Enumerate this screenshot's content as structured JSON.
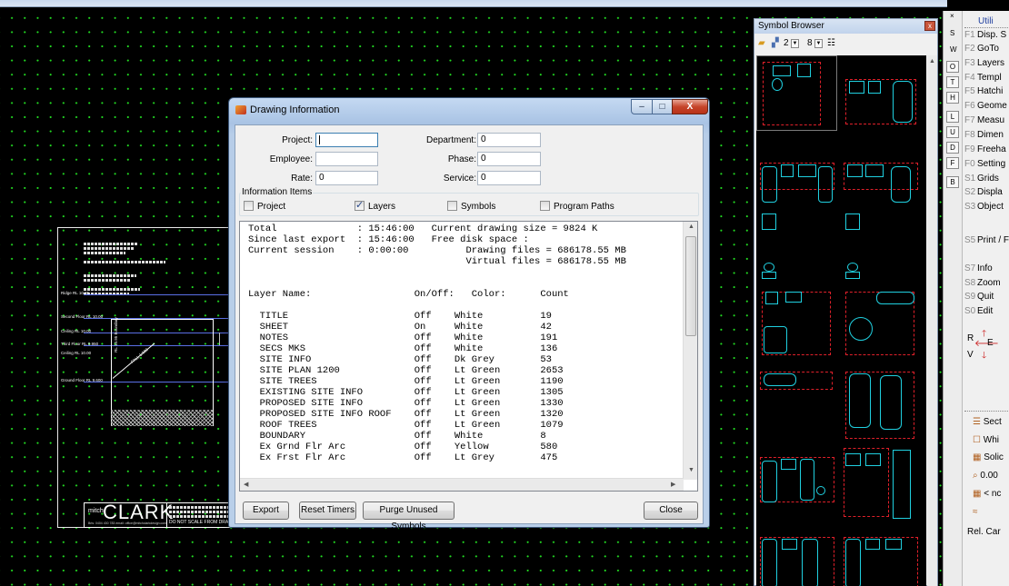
{
  "dialog": {
    "title": "Drawing Information",
    "caption_buttons": {
      "minimize": "–",
      "maximize": "□",
      "close": "X"
    },
    "fields": {
      "project_label": "Project:",
      "project_value": "",
      "employee_label": "Employee:",
      "employee_value": "",
      "rate_label": "Rate:",
      "rate_value": "0",
      "department_label": "Department:",
      "department_value": "0",
      "phase_label": "Phase:",
      "phase_value": "0",
      "service_label": "Service:",
      "service_value": "0"
    },
    "info_items": {
      "legend": "Information Items",
      "project": {
        "label": "Project",
        "checked": false
      },
      "layers": {
        "label": "Layers",
        "checked": true
      },
      "symbols": {
        "label": "Symbols",
        "checked": false
      },
      "program_paths": {
        "label": "Program Paths",
        "checked": false
      }
    },
    "summary_lines": [
      "Total              : 15:46:00   Current drawing size = 9824 K",
      "Since last export  : 15:46:00   Free disk space :",
      "Current session    : 0:00:00          Drawing files = 686178.55 MB",
      "                                      Virtual files = 686178.55 MB"
    ],
    "layer_table": {
      "headers": {
        "name": "Layer Name:",
        "onoff": "On/Off:",
        "color": "Color:",
        "count": "Count"
      },
      "rows": [
        {
          "name": "TITLE",
          "onoff": "Off",
          "color": "White",
          "count": "19"
        },
        {
          "name": "SHEET",
          "onoff": "On",
          "color": "White",
          "count": "42"
        },
        {
          "name": "NOTES",
          "onoff": "Off",
          "color": "White",
          "count": "191"
        },
        {
          "name": "SECS MKS",
          "onoff": "Off",
          "color": "White",
          "count": "136"
        },
        {
          "name": "SITE INFO",
          "onoff": "Off",
          "color": "Dk Grey",
          "count": "53"
        },
        {
          "name": "SITE PLAN 1200",
          "onoff": "Off",
          "color": "Lt Green",
          "count": "2653"
        },
        {
          "name": "SITE TREES",
          "onoff": "Off",
          "color": "Lt Green",
          "count": "1190"
        },
        {
          "name": "EXISTING SITE INFO",
          "onoff": "Off",
          "color": "Lt Green",
          "count": "1305"
        },
        {
          "name": "PROPOSED SITE INFO",
          "onoff": "Off",
          "color": "Lt Green",
          "count": "1330"
        },
        {
          "name": "PROPOSED SITE INFO ROOF",
          "onoff": "Off",
          "color": "Lt Green",
          "count": "1320"
        },
        {
          "name": "ROOF TREES",
          "onoff": "Off",
          "color": "Lt Green",
          "count": "1079"
        },
        {
          "name": "BOUNDARY",
          "onoff": "Off",
          "color": "White",
          "count": "8"
        },
        {
          "name": "Ex Grnd Flr Arc",
          "onoff": "Off",
          "color": "Yellow",
          "count": "580"
        },
        {
          "name": "Ex Frst Flr Arc",
          "onoff": "Off",
          "color": "Lt Grey",
          "count": "475"
        }
      ]
    },
    "buttons": {
      "export": "Export",
      "reset_timers": "Reset Timers",
      "purge": "Purge Unused Symbols",
      "close": "Close"
    }
  },
  "symbol_browser": {
    "title": "Symbol Browser",
    "close": "x",
    "columns_value": "2",
    "rows_value": "8"
  },
  "utilities": {
    "title": "Utili",
    "close_x": "×",
    "items": [
      {
        "key": "F1",
        "label": "Disp. S"
      },
      {
        "key": "F2",
        "label": "GoTo"
      },
      {
        "key": "F3",
        "label": "Layers"
      },
      {
        "key": "F4",
        "label": "Templ"
      },
      {
        "key": "F5",
        "label": "Hatchi"
      },
      {
        "key": "F6",
        "label": "Geome"
      },
      {
        "key": "F7",
        "label": "Measu"
      },
      {
        "key": "F8",
        "label": "Dimen"
      },
      {
        "key": "F9",
        "label": "Freeha"
      },
      {
        "key": "F0",
        "label": "Setting"
      },
      {
        "key": "S1",
        "label": "Grids"
      },
      {
        "key": "S2",
        "label": "Displa"
      },
      {
        "key": "S3",
        "label": "Object"
      },
      {
        "key": "S5",
        "label": "Print / F"
      },
      {
        "key": "S7",
        "label": "Info"
      },
      {
        "key": "S8",
        "label": "Zoom"
      },
      {
        "key": "S9",
        "label": "Quit"
      },
      {
        "key": "S0",
        "label": "Edit"
      }
    ],
    "side_letters": [
      "S",
      "W",
      "O",
      "T",
      "H",
      "L",
      "U",
      "D",
      "F",
      "B"
    ],
    "nav": {
      "r": "R",
      "e": "E",
      "v": "V"
    },
    "properties": [
      {
        "label": "Sect"
      },
      {
        "label": "Whi"
      },
      {
        "label": "Solic"
      },
      {
        "label": "0.00"
      },
      {
        "label": "< nc"
      },
      {
        "label": ""
      },
      {
        "label": "Rel. Car"
      }
    ]
  },
  "drawing": {
    "title_block_logo": "CLARK",
    "title_block_small": "mitch",
    "title_block_sub": "Bris: 0404 430 783    email: office@mitchclarkdesign.com",
    "title_block_note": "DO NOT SCALE FROM DRAWING",
    "levels": [
      "Ridge RL 10.95",
      "Second Floor RL 10.00",
      "Ceiling RL 10.00",
      "Third Floor RL 9.950",
      "Ceiling RL 10.00",
      "Ground Floor RL 9.600"
    ],
    "slope_label": "FALL 1:100",
    "rl_label": "RL 10.95 Boundary"
  },
  "colors": {
    "grid_dot": "#22dd22",
    "symbol_line": "#20d0e0",
    "symbol_dash": "#e0202a",
    "dialog_frame": "#a9c3e4"
  }
}
